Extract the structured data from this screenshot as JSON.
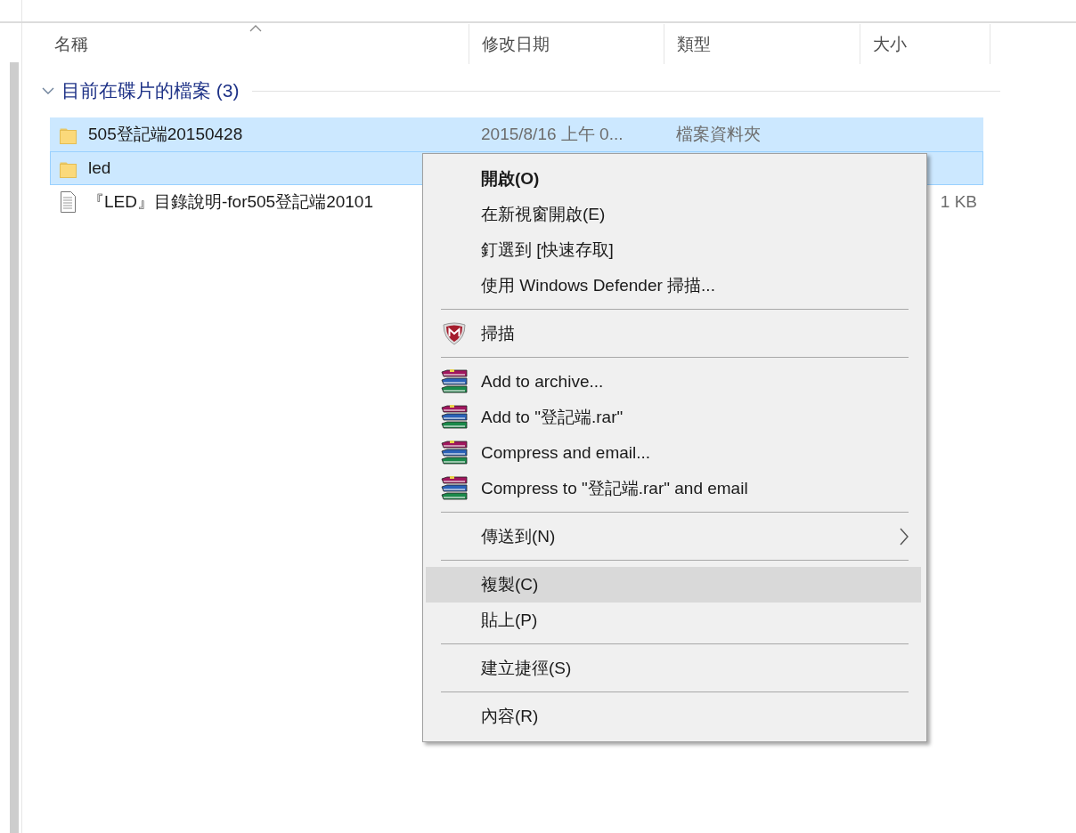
{
  "columns": [
    {
      "label": "名稱",
      "sorted": true
    },
    {
      "label": "修改日期",
      "sorted": false
    },
    {
      "label": "類型",
      "sorted": false
    },
    {
      "label": "大小",
      "sorted": false
    }
  ],
  "group": {
    "title": "目前在碟片的檔案 (3)",
    "expanded": true
  },
  "rows": [
    {
      "kind": "folder",
      "name": "505登記端20150428",
      "date": "2015/8/16 上午 0...",
      "type": "檔案資料夾",
      "selected": true,
      "focused": false
    },
    {
      "kind": "folder",
      "name": "led",
      "selected": true,
      "focused": true
    },
    {
      "kind": "document",
      "name": "『LED』目錄說明-for505登記端20101",
      "size": "1 KB",
      "selected": false,
      "focused": false
    }
  ],
  "context_menu": {
    "sections": [
      {
        "items": [
          {
            "label": "開啟(O)",
            "default": true,
            "selected": false
          },
          {
            "label": "在新視窗開啟(E)",
            "default": false,
            "selected": false
          },
          {
            "label": "釘選到 [快速存取]",
            "default": false,
            "selected": false
          },
          {
            "label": "使用 Windows Defender 掃描...",
            "default": false,
            "selected": false
          }
        ]
      },
      {
        "items": [
          {
            "label": "掃描",
            "kind": "shield",
            "default": false,
            "selected": false
          }
        ]
      },
      {
        "items": [
          {
            "label": "Add to archive...",
            "kind": "archive",
            "default": false,
            "selected": false
          },
          {
            "label": "Add to \"登記端.rar\"",
            "kind": "archive",
            "default": false,
            "selected": false
          },
          {
            "label": "Compress and email...",
            "kind": "archive",
            "default": false,
            "selected": false
          },
          {
            "label": "Compress to \"登記端.rar\" and email",
            "kind": "archive",
            "default": false,
            "selected": false
          }
        ]
      },
      {
        "items": [
          {
            "label": "傳送到(N)",
            "submenu": true,
            "default": false,
            "selected": false
          }
        ]
      },
      {
        "items": [
          {
            "label": "複製(C)",
            "default": false,
            "selected": true
          },
          {
            "label": "貼上(P)",
            "default": false,
            "selected": false
          }
        ]
      },
      {
        "items": [
          {
            "label": "建立捷徑(S)",
            "default": false,
            "selected": false
          }
        ]
      },
      {
        "items": [
          {
            "label": "內容(R)",
            "default": false,
            "selected": false
          }
        ]
      }
    ]
  }
}
